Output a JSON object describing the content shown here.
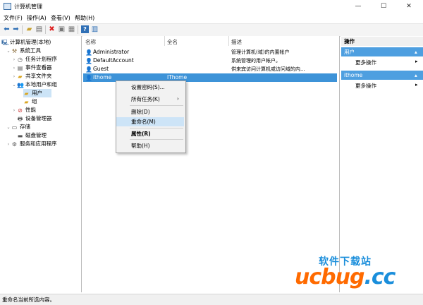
{
  "window": {
    "title": "计算机管理"
  },
  "menu": [
    "文件(F)",
    "操作(A)",
    "查看(V)",
    "帮助(H)"
  ],
  "toolbar_icons": [
    "back-icon",
    "forward-icon",
    "up-folder-icon",
    "properties-icon",
    "delete-icon",
    "refresh-icon",
    "export-icon",
    "help-icon",
    "show-hide-icon"
  ],
  "tree": {
    "root": "计算机管理(本地)",
    "system_tools": "系统工具",
    "task_scheduler": "任务计划程序",
    "event_viewer": "事件查看器",
    "shared_folders": "共享文件夹",
    "local_users": "本地用户和组",
    "users": "用户",
    "groups": "组",
    "performance": "性能",
    "device_manager": "设备管理器",
    "storage": "存储",
    "disk_management": "磁盘管理",
    "services": "服务和应用程序"
  },
  "list": {
    "columns": [
      "名称",
      "全名",
      "描述"
    ],
    "rows": [
      {
        "name": "Administrator",
        "fullname": "",
        "desc": "管理计算机(域)的内置帐户"
      },
      {
        "name": "DefaultAccount",
        "fullname": "",
        "desc": "系统管理的用户帐户。"
      },
      {
        "name": "Guest",
        "fullname": "",
        "desc": "供来宾访问计算机或访问域的内..."
      },
      {
        "name": "ithome",
        "fullname": "IThome",
        "desc": ""
      }
    ]
  },
  "context_menu": {
    "set_password": "设置密码(S)...",
    "all_tasks": "所有任务(K)",
    "delete": "删除(D)",
    "rename": "重命名(M)",
    "properties": "属性(R)",
    "help": "帮助(H)"
  },
  "actions": {
    "header": "操作",
    "section1": "用户",
    "section1_more": "更多操作",
    "section2": "ithome",
    "section2_more": "更多操作"
  },
  "status": "重命名当前所选内容。",
  "watermark": {
    "top": "软件下载站",
    "main": "ucbug",
    "suffix": ".cc"
  },
  "colors": {
    "selection": "#3d93d8",
    "highlight": "#cde4f7",
    "action_header": "#4e9fe0"
  }
}
